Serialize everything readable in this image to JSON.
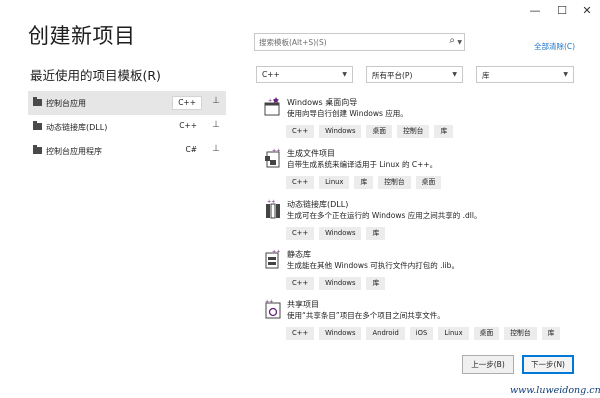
{
  "window": {
    "minimize": "—",
    "maximize": "☐",
    "close": "✕"
  },
  "title": "创建新项目",
  "recent": {
    "heading": "最近使用的项目模板(R)",
    "items": [
      {
        "label": "控制台应用",
        "lang": "C++",
        "pin": "⊥"
      },
      {
        "label": "动态链接库(DLL)",
        "lang": "C++",
        "pin": "⊥"
      },
      {
        "label": "控制台应用程序",
        "lang": "C#",
        "pin": "⊥"
      }
    ]
  },
  "search": {
    "placeholder": "搜索模板(Alt+S)(S)",
    "icon": "search-icon"
  },
  "clear_all": "全部清除(C)",
  "filters": {
    "language": "C++",
    "platform": "所有平台(P)",
    "project_type": "库"
  },
  "templates": [
    {
      "name": "Windows 桌面向导",
      "desc": "使用向导自行创建 Windows 应用。",
      "tags": [
        "C++",
        "Windows",
        "桌面",
        "控制台",
        "库"
      ]
    },
    {
      "name": "生成文件项目",
      "desc": "自带生成系统来编译适用于 Linux 的 C++。",
      "tags": [
        "C++",
        "Linux",
        "库",
        "控制台",
        "桌面"
      ]
    },
    {
      "name": "动态链接库(DLL)",
      "desc": "生成可在多个正在运行的 Windows 应用之间共享的 .dll。",
      "tags": [
        "C++",
        "Windows",
        "库"
      ]
    },
    {
      "name": "静态库",
      "desc": "生成能在其他 Windows 可执行文件内打包的 .lib。",
      "tags": [
        "C++",
        "Windows",
        "库"
      ]
    },
    {
      "name": "共享项目",
      "desc": "使用“共享条目”项目在多个项目之间共享文件。",
      "tags": [
        "C++",
        "Windows",
        "Android",
        "iOS",
        "Linux",
        "桌面",
        "控制台",
        "库"
      ]
    }
  ],
  "buttons": {
    "back": "上一步(B)",
    "next": "下一步(N)"
  },
  "watermark": "www.luweidong.cn",
  "colors": {
    "accent": "#0078d7",
    "link": "#1a73c8",
    "icon_purple": "#68217a",
    "selected_bg": "#e6e6e6"
  }
}
